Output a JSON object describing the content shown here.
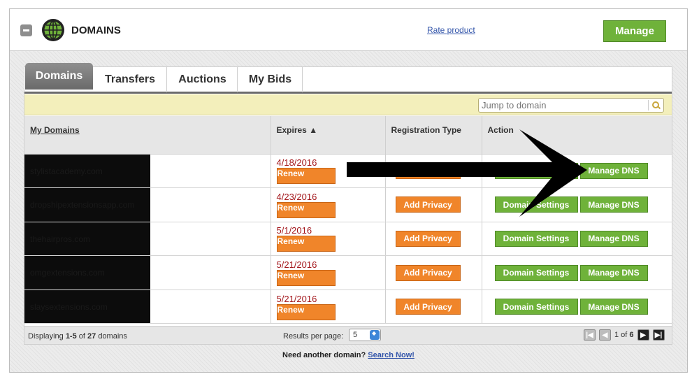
{
  "header": {
    "title": "DOMAINS",
    "rate_link": "Rate product",
    "manage_label": "Manage",
    "icon": "globe-icon"
  },
  "tabs": [
    "Domains",
    "Transfers",
    "Auctions",
    "My Bids"
  ],
  "search": {
    "placeholder": "Jump to domain",
    "icon": "search-icon"
  },
  "table": {
    "headers": {
      "domain": "My Domains",
      "expires": "Expires ▲",
      "reg_type": "Registration Type",
      "action": "Action"
    },
    "rows": [
      {
        "domain": "stylistacademy.com",
        "expires": "4/18/2016",
        "renew": "Renew",
        "privacy": "Add Privacy",
        "settings": "Domain Settings",
        "dns": "Manage DNS"
      },
      {
        "domain": "dropshipextensionsapp.com",
        "expires": "4/23/2016",
        "renew": "Renew",
        "privacy": "Add Privacy",
        "settings": "Domain Settings",
        "dns": "Manage DNS"
      },
      {
        "domain": "thehairpros.com",
        "expires": "5/1/2016",
        "renew": "Renew",
        "privacy": "Add Privacy",
        "settings": "Domain Settings",
        "dns": "Manage DNS"
      },
      {
        "domain": "omgextensions.com",
        "expires": "5/21/2016",
        "renew": "Renew",
        "privacy": "Add Privacy",
        "settings": "Domain Settings",
        "dns": "Manage DNS"
      },
      {
        "domain": "slaysextensions.com",
        "expires": "5/21/2016",
        "renew": "Renew",
        "privacy": "Add Privacy",
        "settings": "Domain Settings",
        "dns": "Manage DNS"
      }
    ]
  },
  "footer": {
    "displaying_prefix": "Displaying ",
    "range": "1-5",
    "of": " of ",
    "total": "27",
    "suffix": " domains",
    "results_label": "Results per page:",
    "results_value": "5",
    "page_text": "1 of ",
    "page_total": "6"
  },
  "bottom": {
    "text": "Need another domain? ",
    "link": "Search Now!"
  },
  "colors": {
    "green": "#6fb23a",
    "orange": "#f0852a",
    "tab_active": "#7a7a7a",
    "toolbar": "#f3efbb"
  }
}
